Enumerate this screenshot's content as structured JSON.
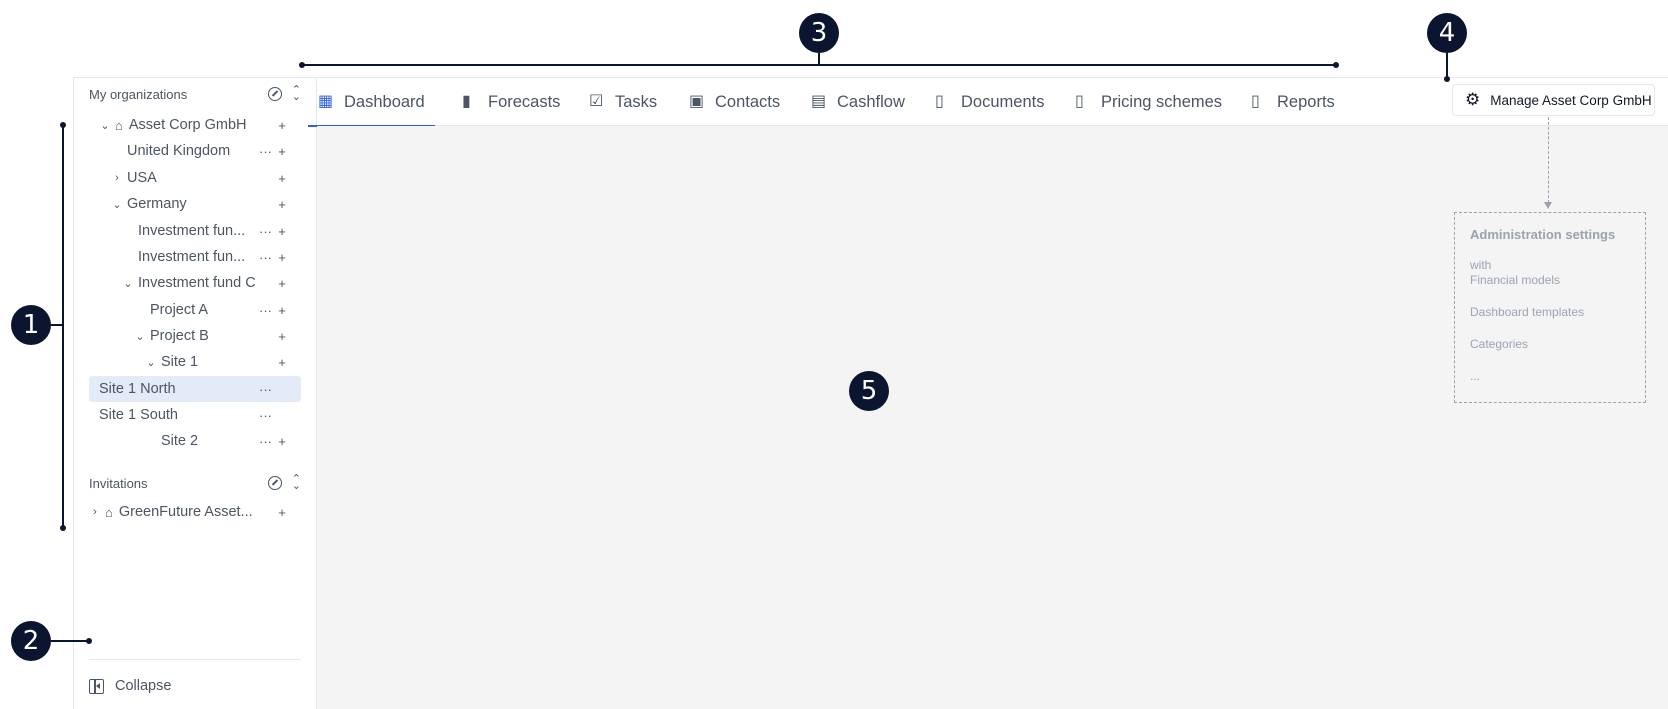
{
  "markers": [
    "1",
    "2",
    "3",
    "4",
    "5"
  ],
  "sidebar": {
    "organizations_heading": "My organizations",
    "invitations_heading": "Invitations",
    "collapse_label": "Collapse",
    "tree": [
      {
        "label": "Asset Corp GmbH",
        "chevron": "down",
        "icon": "house-icon",
        "more": false,
        "add": true
      },
      {
        "label": "United Kingdom",
        "chevron": "none",
        "more": true,
        "add": true
      },
      {
        "label": "USA",
        "chevron": "right",
        "more": false,
        "add": true
      },
      {
        "label": "Germany",
        "chevron": "down",
        "more": false,
        "add": true
      },
      {
        "label": "Investment fun...",
        "chevron": "none",
        "more": true,
        "add": true
      },
      {
        "label": "Investment fun...",
        "chevron": "none",
        "more": true,
        "add": true
      },
      {
        "label": "Investment fund C",
        "chevron": "down",
        "more": false,
        "add": true
      },
      {
        "label": "Project A",
        "chevron": "none",
        "more": true,
        "add": true
      },
      {
        "label": "Project B",
        "chevron": "down",
        "more": false,
        "add": true
      },
      {
        "label": "Site 1",
        "chevron": "down",
        "more": false,
        "add": true
      },
      {
        "label": "Site 1 North",
        "chevron": "none",
        "more": true,
        "add": false,
        "selected": true
      },
      {
        "label": "Site 1 South",
        "chevron": "none",
        "more": true,
        "add": false
      },
      {
        "label": "Site 2",
        "chevron": "none",
        "more": true,
        "add": true
      }
    ],
    "invitations": [
      {
        "label": "GreenFuture Asset...",
        "chevron": "right",
        "icon": "house-icon",
        "add": true
      }
    ],
    "more_glyph": "···",
    "add_glyph": "+"
  },
  "tabs": [
    {
      "label": "Dashboard",
      "icon": "dashboard-icon",
      "active": true
    },
    {
      "label": "Forecasts",
      "icon": "bar-chart-icon"
    },
    {
      "label": "Tasks",
      "icon": "tasks-icon"
    },
    {
      "label": "Contacts",
      "icon": "contacts-icon"
    },
    {
      "label": "Cashflow",
      "icon": "wallet-icon"
    },
    {
      "label": "Documents",
      "icon": "document-icon"
    },
    {
      "label": "Pricing schemes",
      "icon": "pricing-icon"
    },
    {
      "label": "Reports",
      "icon": "report-icon"
    }
  ],
  "manage_button": {
    "label": "Manage Asset Corp GmbH",
    "icon": "gear-icon"
  },
  "admin_settings": {
    "title": "Administration settings",
    "items": [
      "with\nFinancial models",
      "Dashboard templates",
      "Categories",
      "..."
    ]
  },
  "colors": {
    "accent": "#2f5fdc",
    "marker": "#0b1530",
    "selected_row": "#e4ebf8",
    "content_bg": "#f4f4f4"
  }
}
